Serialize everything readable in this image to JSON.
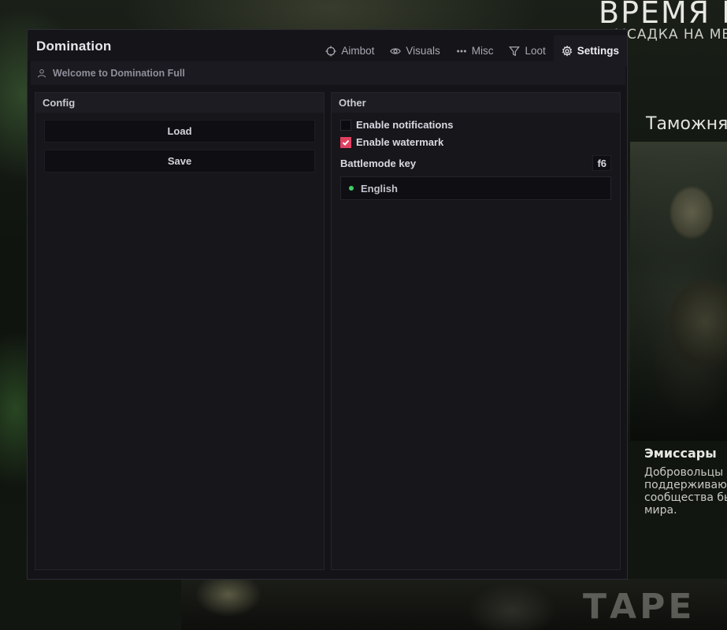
{
  "background": {
    "title_line1": "ВРЕМЯ П",
    "title_line2": "ЫСАДКА НА МЕС",
    "location": "Таможня",
    "heading": "Эмиссары",
    "paragraph": "Добровольцы со\nподдерживают Т\nсообщества был\nмира.",
    "logo_fragment": "ТАРЕ"
  },
  "app": {
    "title": "Domination",
    "welcome": "Welcome to Domination Full",
    "accent_color": "#e0405f",
    "status_color": "#3fd06a"
  },
  "tabs": [
    {
      "label": "Aimbot",
      "icon": "crosshair-icon",
      "active": false
    },
    {
      "label": "Visuals",
      "icon": "eye-icon",
      "active": false
    },
    {
      "label": "Misc",
      "icon": "more-horizontal-icon",
      "active": false
    },
    {
      "label": "Loot",
      "icon": "filter-icon",
      "active": false
    },
    {
      "label": "Settings",
      "icon": "gear-icon",
      "active": true
    }
  ],
  "config": {
    "title": "Config",
    "load_label": "Load",
    "save_label": "Save"
  },
  "other": {
    "title": "Other",
    "notifications_label": "Enable notifications",
    "notifications_checked": false,
    "watermark_label": "Enable watermark",
    "watermark_checked": true,
    "battlemode_label": "Battlemode key",
    "battlemode_value": "f6",
    "language_value": "English"
  }
}
